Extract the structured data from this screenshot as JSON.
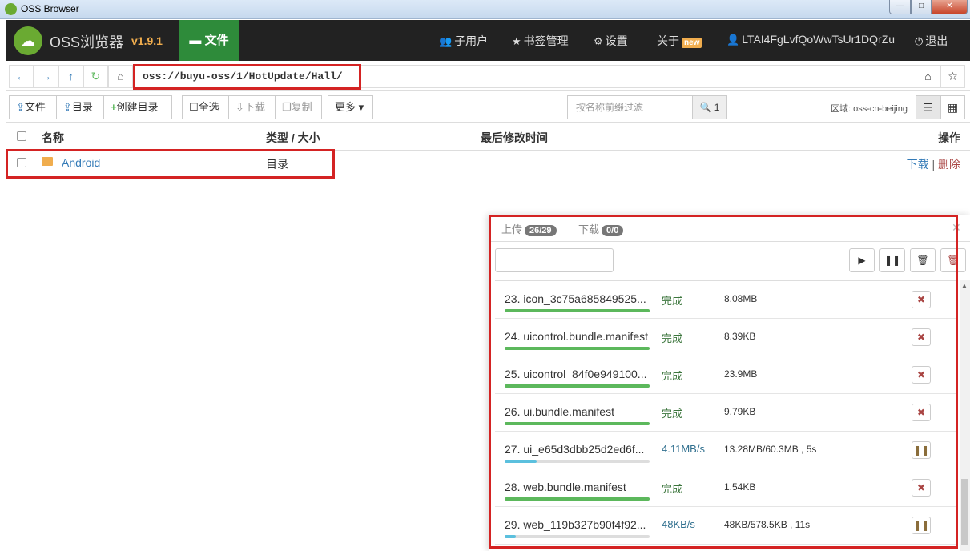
{
  "window": {
    "title": "OSS Browser",
    "min": "—",
    "max": "□",
    "close": "✕"
  },
  "nav": {
    "brand": "OSS浏览器",
    "version": "v1.9.1",
    "file_tab": "文件",
    "sub_users": "子用户",
    "bookmarks": "书签管理",
    "settings": "设置",
    "about": "关于",
    "new_badge": "new",
    "account": "LTAI4FgLvfQoWwTsUr1DQrZu",
    "logout": "退出"
  },
  "address": {
    "path": "oss://buyu-oss/1/HotUpdate/Hall/"
  },
  "toolbar": {
    "upload_file": "文件",
    "upload_dir": "目录",
    "create_dir": "创建目录",
    "select_all": "全选",
    "download": "下载",
    "copy": "复制",
    "more": "更多",
    "filter_placeholder": "按名称前缀过滤",
    "filter_count": "1",
    "region": "区域: oss-cn-beijing"
  },
  "table": {
    "headers": {
      "name": "名称",
      "type_size": "类型 / 大小",
      "modified": "最后修改时间",
      "ops": "操作"
    },
    "rows": [
      {
        "name": "Android",
        "type": "目录",
        "download": "下载",
        "delete": "删除"
      }
    ]
  },
  "transfer": {
    "upload_tab": "上传",
    "upload_count": "26/29",
    "download_tab": "下载",
    "download_count": "0/0",
    "items": [
      {
        "name": "23. icon_3c75a685849525...",
        "status": "完成",
        "size": "8.08MB",
        "progress": 1.0,
        "state": "done"
      },
      {
        "name": "24. uicontrol.bundle.manifest",
        "status": "完成",
        "size": "8.39KB",
        "progress": 1.0,
        "state": "done"
      },
      {
        "name": "25. uicontrol_84f0e949100...",
        "status": "完成",
        "size": "23.9MB",
        "progress": 1.0,
        "state": "done"
      },
      {
        "name": "26. ui.bundle.manifest",
        "status": "完成",
        "size": "9.79KB",
        "progress": 1.0,
        "state": "done"
      },
      {
        "name": "27. ui_e65d3dbb25d2ed6f...",
        "status": "4.11MB/s",
        "size": "13.28MB/60.3MB , 5s",
        "progress": 0.22,
        "state": "running"
      },
      {
        "name": "28. web.bundle.manifest",
        "status": "完成",
        "size": "1.54KB",
        "progress": 1.0,
        "state": "done"
      },
      {
        "name": "29. web_119b327b90f4f92...",
        "status": "48KB/s",
        "size": "48KB/578.5KB , 11s",
        "progress": 0.08,
        "state": "running"
      }
    ]
  },
  "colors": {
    "done": "#5cb85c",
    "running": "#5bc0de",
    "running_text": "#31708f",
    "done_text": "#3c763d"
  }
}
